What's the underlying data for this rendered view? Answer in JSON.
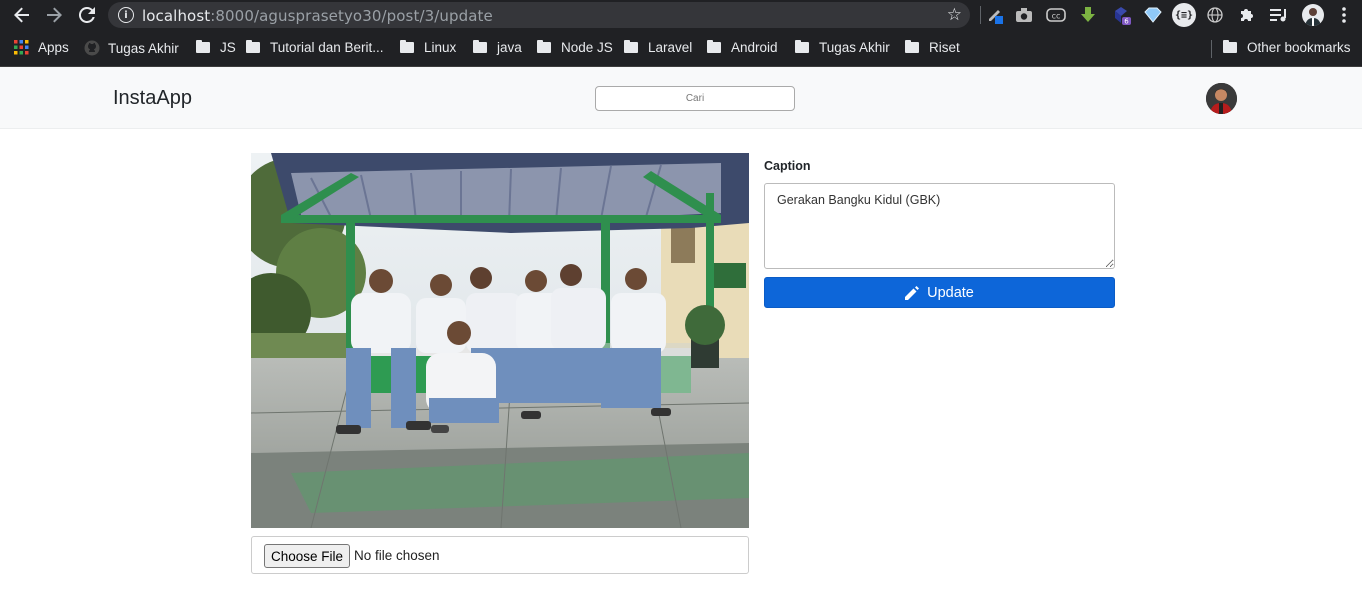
{
  "browser": {
    "url_host": "localhost",
    "url_path": ":8000/agusprasetyo30/post/3/update",
    "extension_badge_count": "6"
  },
  "bookmarks": {
    "apps_label": "Apps",
    "items": [
      "Tugas Akhir",
      "JS",
      "Tutorial dan Berit...",
      "Linux",
      "java",
      "Node JS",
      "Laravel",
      "Android",
      "Tugas Akhir",
      "Riset"
    ],
    "other_label": "Other bookmarks"
  },
  "navbar": {
    "brand": "InstaApp",
    "search_placeholder": "Cari"
  },
  "form": {
    "choose_file_label": "Choose File",
    "no_file_text": "No file chosen",
    "caption_label": "Caption",
    "caption_value": "Gerakan Bangku Kidul (GBK)",
    "update_label": "Update"
  },
  "colors": {
    "primary": "#0d66d9",
    "chrome_bg": "#202124"
  }
}
